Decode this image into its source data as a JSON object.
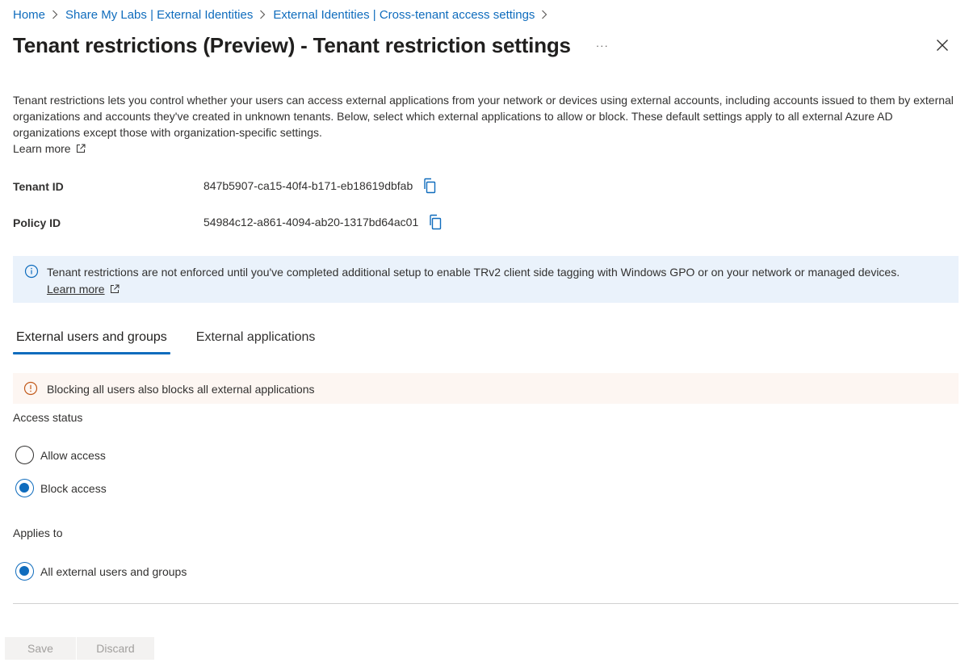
{
  "breadcrumb": [
    {
      "label": "Home"
    },
    {
      "label": "Share My Labs | External Identities"
    },
    {
      "label": "External Identities | Cross-tenant access settings"
    }
  ],
  "header": {
    "title": "Tenant restrictions (Preview) - Tenant restriction settings",
    "more_label": "···"
  },
  "description": "Tenant restrictions lets you control whether your users can access external applications from your network or devices using external accounts, including accounts issued to them by external organizations and accounts they've created in unknown tenants. Below, select which external applications to allow or block. These default settings apply to all external Azure AD organizations except those with organization-specific settings.",
  "learn_more": "Learn more",
  "fields": {
    "tenant_id": {
      "label": "Tenant ID",
      "value": "847b5907-ca15-40f4-b171-eb18619dbfab"
    },
    "policy_id": {
      "label": "Policy ID",
      "value": "54984c12-a861-4094-ab20-1317bd64ac01"
    }
  },
  "info_banner": {
    "text": "Tenant restrictions are not enforced until you've completed additional setup to enable TRv2 client side tagging with Windows GPO or on your network or managed devices.",
    "link": "Learn more"
  },
  "tabs": [
    {
      "label": "External users and groups",
      "active": true
    },
    {
      "label": "External applications",
      "active": false
    }
  ],
  "warning_banner": {
    "text": "Blocking all users also blocks all external applications"
  },
  "access_status": {
    "label": "Access status",
    "options": [
      {
        "label": "Allow access",
        "checked": false
      },
      {
        "label": "Block access",
        "checked": true
      }
    ]
  },
  "applies_to": {
    "label": "Applies to",
    "options": [
      {
        "label": "All external users and groups",
        "checked": true
      }
    ]
  },
  "footer": {
    "save_label": "Save",
    "discard_label": "Discard"
  },
  "colors": {
    "accent": "#0f6cbd",
    "info_bg": "#eaf2fb",
    "warning_bg": "#fdf6f2",
    "warning_icon": "#c25a1b"
  },
  "icons": [
    "chevron-right-icon",
    "more-icon",
    "close-icon",
    "external-link-icon",
    "copy-icon",
    "info-icon",
    "warning-icon"
  ]
}
